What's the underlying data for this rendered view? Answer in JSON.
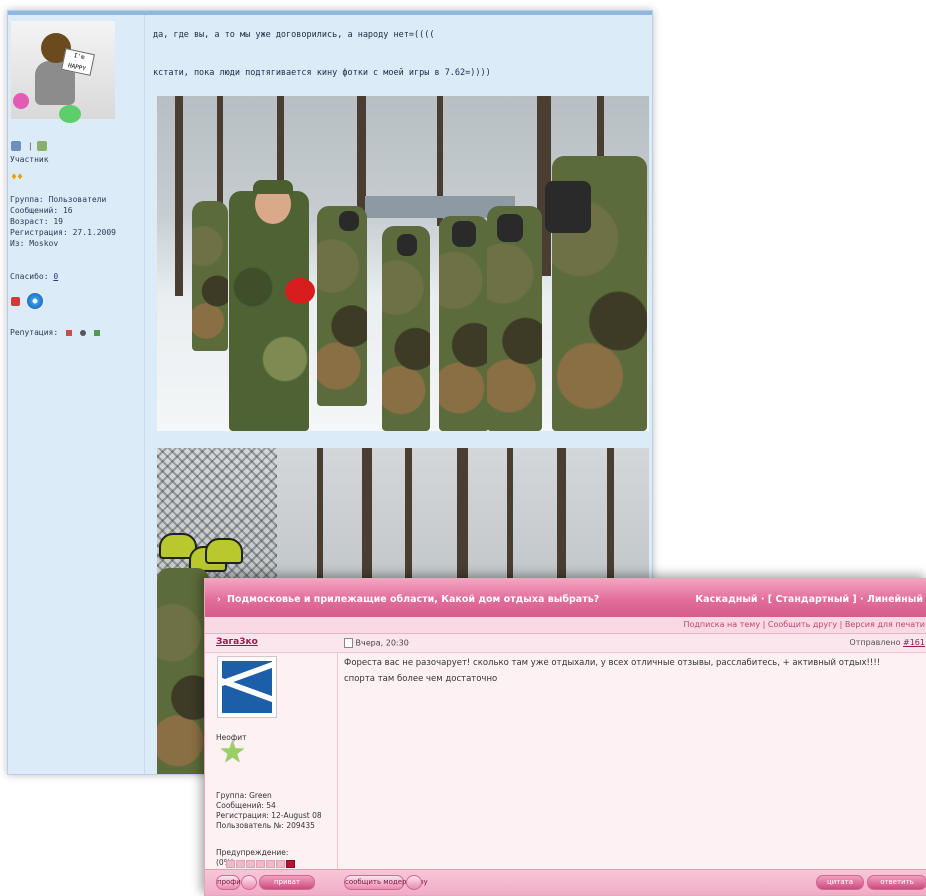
{
  "back_post": {
    "user_role": "Участник",
    "group": "Группа: Пользователи",
    "posts": "Сообщений: 16",
    "age": "Возраст: 19",
    "registered": "Регистрация: 27.1.2009",
    "from": "Из: Moskov",
    "thanks_label": "Спасибо:",
    "thanks_value": "0",
    "reputation_label": "Репутация:",
    "line1": "да, где вы, а то мы уже договорились, а народу нет=((((",
    "line2": "кстати, пока люди подтягивается кину фотки с моей игры в 7.62=))))",
    "avatar_sign": "I'm HAPPY"
  },
  "front_post": {
    "thread_title": "Подмосковье и прилежащие области, Какой дом отдыха выбрать?",
    "view_modes": "Каскадный · [ Стандартный ] · Линейный",
    "links": [
      "Подписка на тему",
      "Сообщить другу",
      "Версия для печати"
    ],
    "username": "Зага3ко",
    "post_date": "Вчера, 20:30",
    "sent_label": "Отправлено",
    "post_number": "#161",
    "rank": "Неофит",
    "group": "Группа: Green",
    "posts": "Сообщений: 54",
    "registered": "Регистрация: 12-August 08",
    "user_id": "Пользователь №: 209435",
    "warning_label": "Предупреждение:",
    "warning_value": "(0%)",
    "text_line1": "Фореста вас не разочарует! сколько там уже отдыхали, у всех отличные отзывы, расслабитесь, + активный отдых!!!!",
    "text_line2": "спорта там более чем достаточно",
    "buttons": {
      "profile": "профиль",
      "pm": "приват",
      "report": "сообщить модератору",
      "quote": "цитата",
      "reply": "ответить"
    }
  }
}
